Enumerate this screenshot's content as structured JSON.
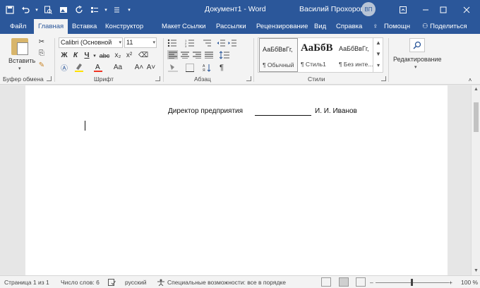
{
  "titlebar": {
    "title": "Документ1  -  Word",
    "user": "Василий Прохоров",
    "initials": "ВП",
    "qat": {
      "save_icon": "save-icon",
      "undo_icon": "undo-icon",
      "redo_icon": "redo-icon"
    }
  },
  "tabs": [
    {
      "label": "Файл"
    },
    {
      "label": "Главная"
    },
    {
      "label": "Вставка"
    },
    {
      "label": "Конструктор"
    },
    {
      "label": "Макет"
    },
    {
      "label": "Ссылки"
    },
    {
      "label": "Рассылки"
    },
    {
      "label": "Рецензирование"
    },
    {
      "label": "Вид"
    },
    {
      "label": "Справка"
    },
    {
      "label": "Помощн"
    },
    {
      "label": "Поделиться"
    }
  ],
  "ribbon": {
    "clipboard": {
      "paste_label": "Вставить",
      "group": "Буфер обмена"
    },
    "font": {
      "family": "Calibri (Основной",
      "size": "11",
      "group": "Шрифт",
      "bold": "Ж",
      "italic": "К",
      "underline": "Ч",
      "strike": "abc",
      "sub": "x₂",
      "sup": "x²",
      "grow": "A˄",
      "shrink": "A˅",
      "aa": "Aa"
    },
    "paragraph": {
      "group": "Абзац",
      "pilcrow": "¶"
    },
    "styles": {
      "group": "Стили",
      "items": [
        {
          "sample": "АаБбВвГг,",
          "name": "¶ Обычный"
        },
        {
          "sample": "АаБбВ",
          "name": "¶ Стиль1"
        },
        {
          "sample": "АаБбВвГг,",
          "name": "¶ Без инте..."
        }
      ]
    },
    "editing": {
      "label": "Редактирование"
    }
  },
  "document": {
    "left_text": "Директор предприятия",
    "right_text": "И. И. Иванов"
  },
  "statusbar": {
    "page": "Страница 1 из 1",
    "words": "Число слов: 6",
    "lang": "русский",
    "accessibility": "Специальные возможности: все в порядке",
    "zoom": "100 %",
    "minus": "–",
    "plus": "+"
  },
  "colors": {
    "accent": "#2b579a",
    "ribbon_bg": "#f3f3f3"
  }
}
